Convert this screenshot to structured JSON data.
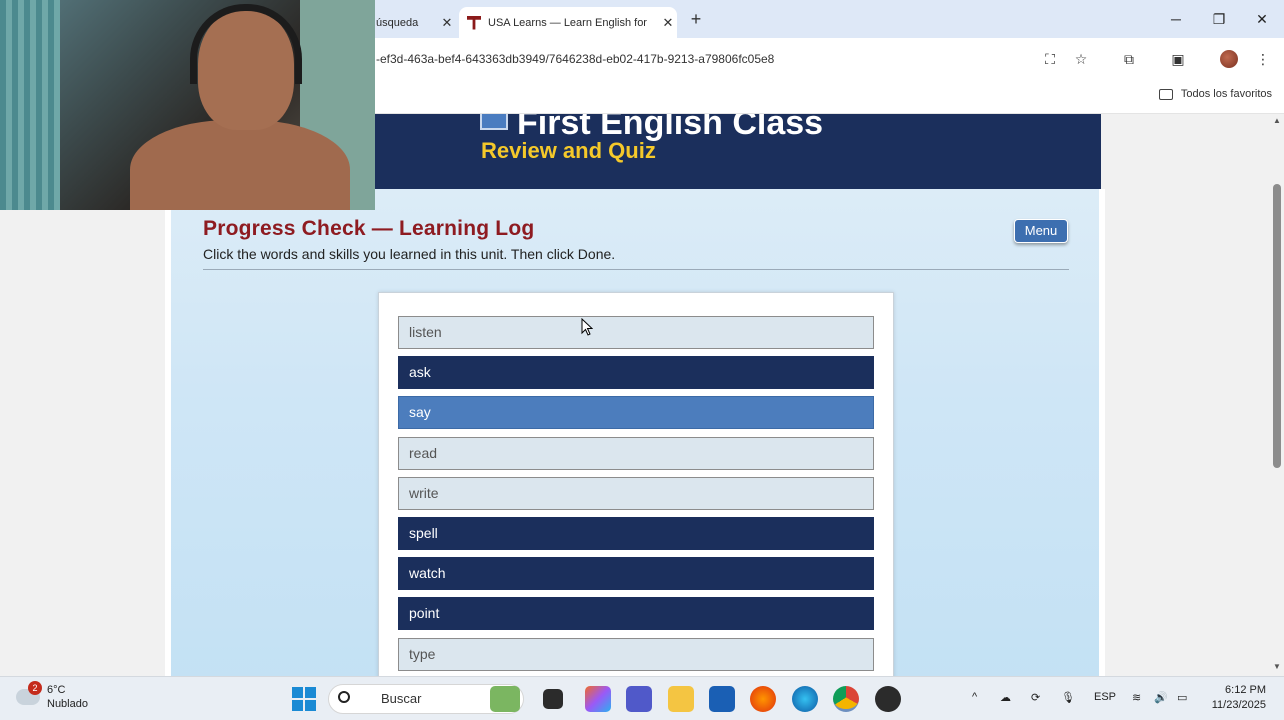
{
  "browser": {
    "tabs": [
      {
        "title": "úsqueda",
        "active": false
      },
      {
        "title": "USA Learns — Learn English for",
        "active": true
      }
    ],
    "new_tab_label": "+",
    "url": "-ef3d-463a-bef4-643363db3949/7646238d-eb02-417b-9213-a79806fc05e8",
    "bookmarks_label": "Todos los favoritos",
    "window_controls": {
      "minimize": "─",
      "maximize": "❐",
      "close": "✕"
    }
  },
  "page": {
    "banner_title": "First English Class",
    "banner_subtitle": "Review and Quiz",
    "progress_title": "Progress Check — Learning Log",
    "instructions": "Click the words and skills you learned in this unit. Then click Done.",
    "menu_label": "Menu",
    "items": [
      {
        "label": "listen",
        "state": "off"
      },
      {
        "label": "ask",
        "state": "on"
      },
      {
        "label": "say",
        "state": "hover"
      },
      {
        "label": "read",
        "state": "off"
      },
      {
        "label": "write",
        "state": "off"
      },
      {
        "label": "spell",
        "state": "on"
      },
      {
        "label": "watch",
        "state": "on"
      },
      {
        "label": "point",
        "state": "on"
      },
      {
        "label": "type",
        "state": "off"
      }
    ],
    "colors": {
      "selected": "#1b2f5c",
      "hover": "#4c7dbd",
      "unselected": "#dbe6ee",
      "title": "#8e1b21",
      "banner_sub": "#f5c92a"
    }
  },
  "taskbar": {
    "weather_temp": "6°C",
    "weather_desc": "Nublado",
    "notification_count": "2",
    "search_placeholder": "Buscar",
    "language": "ESP",
    "time": "6:12 PM",
    "date": "11/23/2025"
  }
}
